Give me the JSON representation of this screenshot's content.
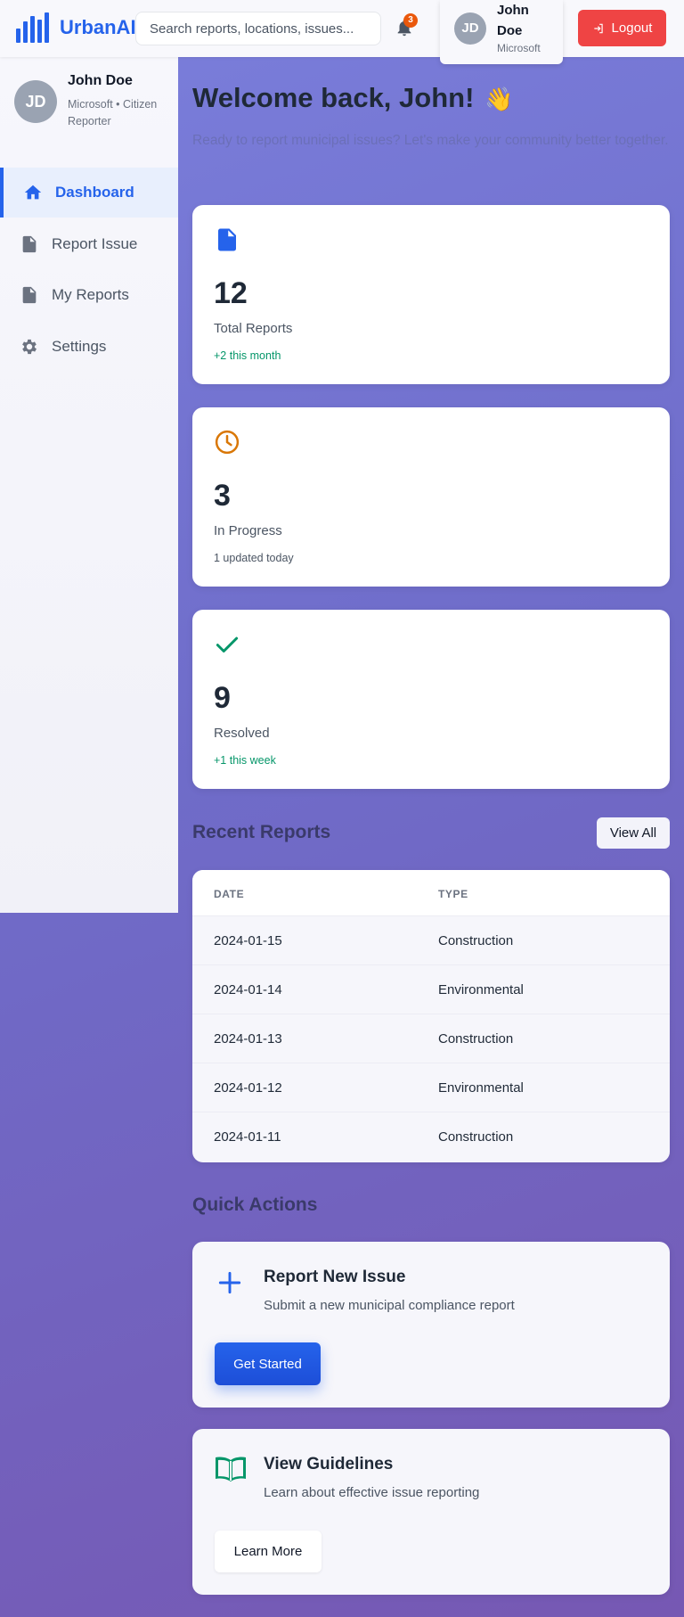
{
  "header": {
    "app_name": "UrbanAI",
    "search_placeholder": "Search reports, locations, issues...",
    "notification_count": "3",
    "user_initials": "JD",
    "user_name": "John Doe",
    "user_org": "Microsoft",
    "logout_label": "Logout"
  },
  "sidebar": {
    "initials": "JD",
    "name": "John Doe",
    "role": "Microsoft • Citizen Reporter",
    "items": [
      {
        "label": "Dashboard",
        "icon": "home-icon",
        "active": true
      },
      {
        "label": "Report Issue",
        "icon": "document-icon",
        "active": false
      },
      {
        "label": "My Reports",
        "icon": "document-icon",
        "active": false
      },
      {
        "label": "Settings",
        "icon": "gear-icon",
        "active": false
      }
    ]
  },
  "main": {
    "welcome": "Welcome back, John!",
    "wave": "👋",
    "subtitle": "Ready to report municipal issues? Let's make your community better together.",
    "stats": [
      {
        "value": "12",
        "label": "Total Reports",
        "note": "+2 this month",
        "icon": "document-icon",
        "color": "#2563eb",
        "note_color": "#059669"
      },
      {
        "value": "3",
        "label": "In Progress",
        "note": "1 updated today",
        "icon": "clock-icon",
        "color": "#d97706",
        "note_color": "#4b5563"
      },
      {
        "value": "9",
        "label": "Resolved",
        "note": "+1 this week",
        "icon": "check-icon",
        "color": "#059669",
        "note_color": "#059669"
      }
    ],
    "recent_reports": {
      "title": "Recent Reports",
      "view_all": "View All",
      "columns": [
        "DATE",
        "TYPE"
      ],
      "rows": [
        {
          "date": "2024-01-15",
          "type": "Construction"
        },
        {
          "date": "2024-01-14",
          "type": "Environmental"
        },
        {
          "date": "2024-01-13",
          "type": "Construction"
        },
        {
          "date": "2024-01-12",
          "type": "Environmental"
        },
        {
          "date": "2024-01-11",
          "type": "Construction"
        }
      ]
    },
    "quick_actions": {
      "title": "Quick Actions",
      "cards": [
        {
          "title": "Report New Issue",
          "desc": "Submit a new municipal compliance report",
          "button": "Get Started",
          "icon": "plus-icon"
        },
        {
          "title": "View Guidelines",
          "desc": "Learn about effective issue reporting",
          "button": "Learn More",
          "icon": "book-icon"
        }
      ]
    }
  },
  "colors": {
    "accent": "#2563eb",
    "logout": "#ef4444",
    "badge": "#ea580c",
    "success": "#059669",
    "warning": "#d97706"
  }
}
